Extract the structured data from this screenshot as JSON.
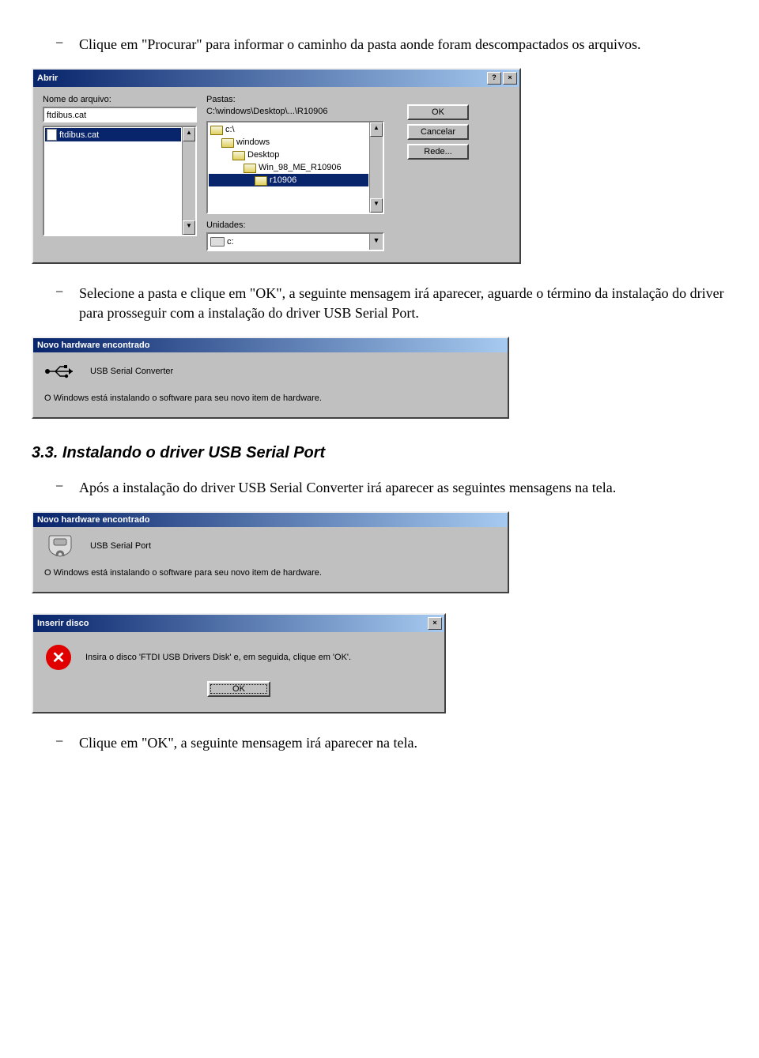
{
  "doc": {
    "bullet1": "Clique em \"Procurar\" para informar o caminho da pasta aonde foram descompactados os arquivos.",
    "bullet2": "Selecione a pasta e clique em \"OK\", a seguinte mensagem irá aparecer, aguarde o término da instalação do driver para prosseguir com a instalação do driver USB Serial Port.",
    "heading": "3.3.  Instalando o driver USB Serial Port",
    "bullet3": "Após a instalação do driver USB Serial Converter irá aparecer as seguintes mensagens na tela.",
    "bullet4": "Clique em \"OK\", a seguinte mensagem irá aparecer na tela."
  },
  "abrir": {
    "title": "Abrir",
    "help_glyph": "?",
    "close_glyph": "×",
    "nome_label": "Nome do arquivo:",
    "nome_value": "ftdibus.cat",
    "file_item": "ftdibus.cat",
    "pastas_label": "Pastas:",
    "pastas_path": "C:\\windows\\Desktop\\...\\R10906",
    "tree": [
      {
        "label": "c:\\",
        "indent": 0,
        "selected": false
      },
      {
        "label": "windows",
        "indent": 1,
        "selected": false
      },
      {
        "label": "Desktop",
        "indent": 2,
        "selected": false
      },
      {
        "label": "Win_98_ME_R10906",
        "indent": 3,
        "selected": false
      },
      {
        "label": "r10906",
        "indent": 4,
        "selected": true
      }
    ],
    "unidades_label": "Unidades:",
    "unidades_value": "c:",
    "btn_ok": "OK",
    "btn_cancel": "Cancelar",
    "btn_rede": "Rede..."
  },
  "novohw1": {
    "title": "Novo hardware encontrado",
    "device": "USB Serial Converter",
    "msg": "O Windows está instalando o software para seu novo item de hardware."
  },
  "novohw2": {
    "title": "Novo hardware encontrado",
    "device": "USB Serial Port",
    "msg": "O Windows está instalando o software para seu novo item de hardware."
  },
  "inserir": {
    "title": "Inserir disco",
    "close_glyph": "×",
    "msg": "Insira o disco 'FTDI USB Drivers Disk' e, em seguida, clique em 'OK'.",
    "btn_ok": "OK"
  }
}
